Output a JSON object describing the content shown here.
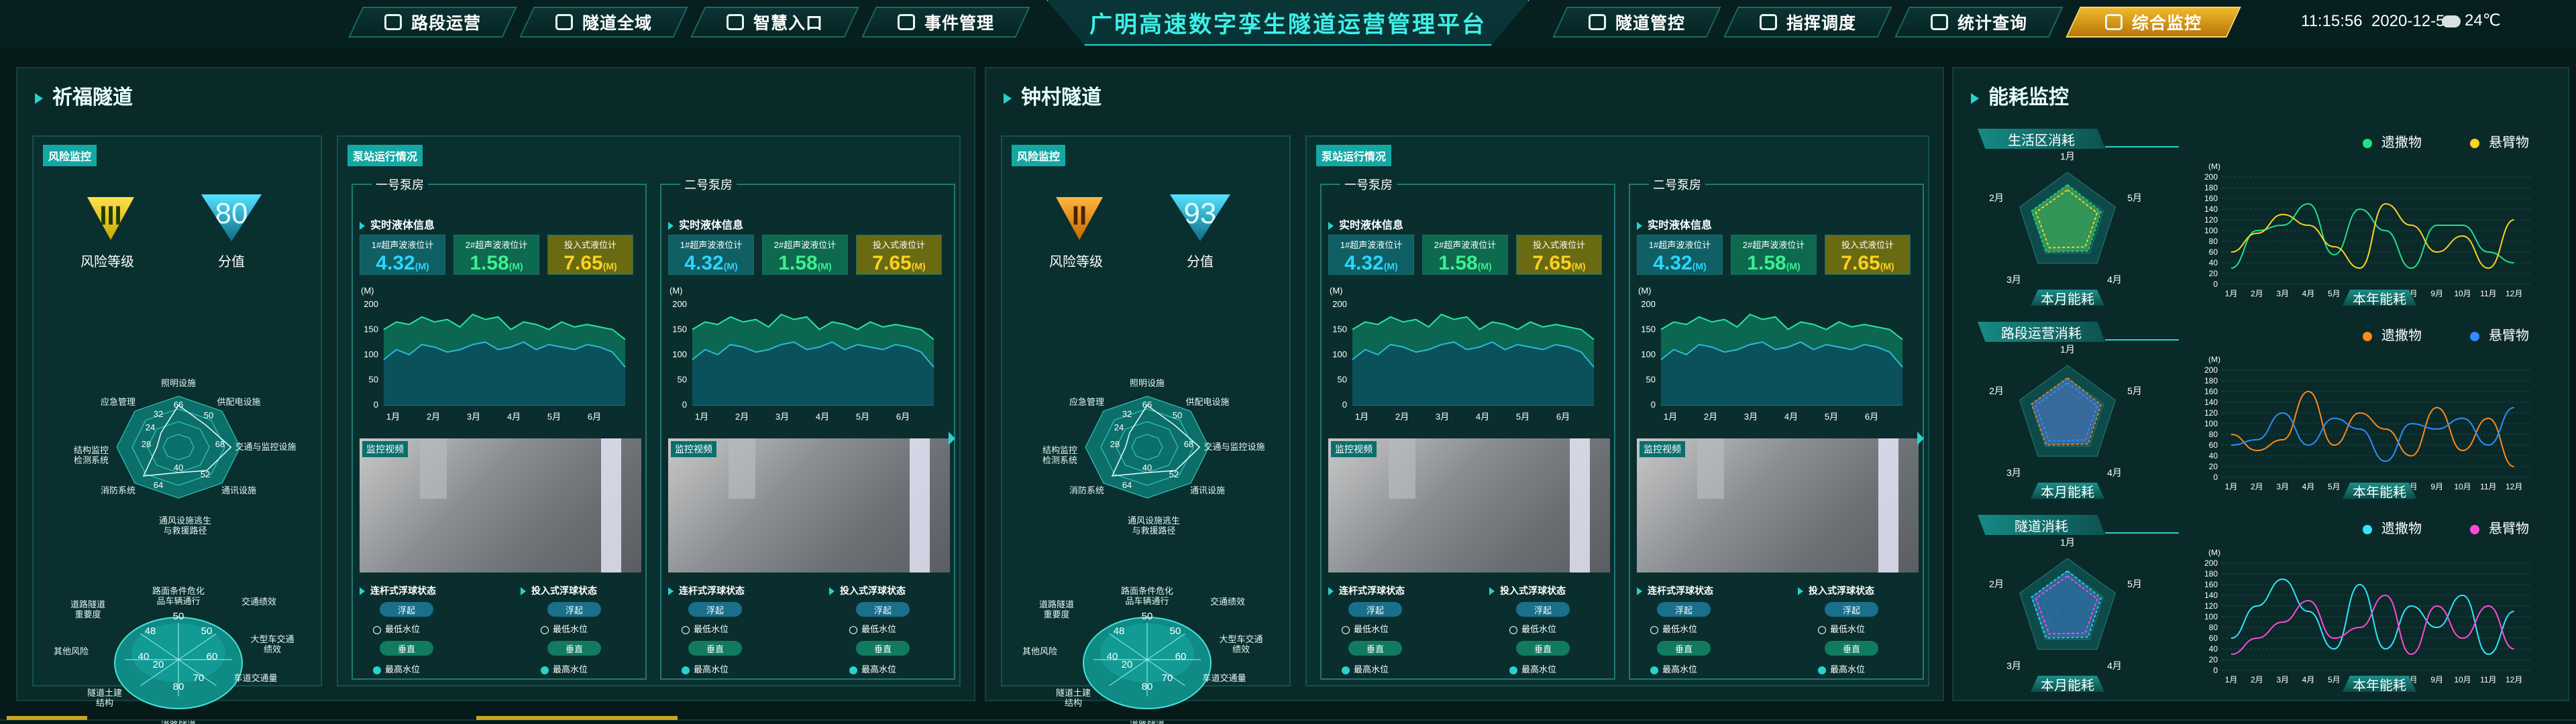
{
  "nav": {
    "left": [
      {
        "label": "路段运营"
      },
      {
        "label": "隧道全域"
      },
      {
        "label": "智慧入口"
      },
      {
        "label": "事件管理"
      }
    ],
    "title": "广明高速数字孪生隧道运营管理平台",
    "right": [
      {
        "label": "隧道管控"
      },
      {
        "label": "指挥调度"
      },
      {
        "label": "统计查询"
      },
      {
        "label": "综合监控"
      }
    ],
    "time": "11:15:56",
    "date": "2020-12-5",
    "weather": "24℃",
    "colors": {
      "accent": "#29d2cd",
      "active": "#f0b82b",
      "bg": "#061a1a"
    }
  },
  "tunnels": [
    {
      "name": "祈福隧道",
      "risk_tag": "风险监控",
      "risk_level": "III",
      "risk_level_label": "风险等级",
      "score": "80",
      "score_label": "分值",
      "radar1": {
        "labels": [
          "照明设施",
          "供配电设施",
          "交通与监控设施",
          "通讯设施",
          "通风设施逃生\n与救援路径",
          "消防系统",
          "结构监控\n检测系统",
          "应急管理"
        ],
        "values": [
          66,
          50,
          68,
          52,
          40,
          64,
          28,
          32,
          24
        ],
        "valuetext": [
          "66",
          "50",
          "68",
          "52",
          "40",
          "64",
          "28",
          "32",
          "24"
        ]
      },
      "radar2": {
        "labels": [
          "路面条件危化\n品车辆通行",
          "交通绩效",
          "大型车交通\n绩效",
          "车道交通量",
          "道路隧道\n线形",
          "隧道土建\n结构",
          "其他风险",
          "道路隧道\n重要度"
        ],
        "vals": [
          "50",
          "50",
          "60",
          "70",
          "80",
          "20",
          "40",
          "48"
        ]
      },
      "pump": {
        "tag": "泵站运行情况",
        "rooms": [
          {
            "name": "一号泵房",
            "section": "实时液体信息",
            "meters": [
              {
                "t": "1#超声波液位计",
                "v": "4.32",
                "u": "(M)"
              },
              {
                "t": "2#超声波液位计",
                "v": "1.58",
                "u": "(M)"
              },
              {
                "t": "投入式液位计",
                "v": "7.65",
                "u": "(M)"
              }
            ]
          },
          {
            "name": "二号泵房",
            "section": "实时液体信息",
            "meters": [
              {
                "t": "1#超声波液位计",
                "v": "4.32",
                "u": "(M)"
              },
              {
                "t": "2#超声波液位计",
                "v": "1.58",
                "u": "(M)"
              },
              {
                "t": "投入式液位计",
                "v": "7.65",
                "u": "(M)"
              }
            ]
          }
        ],
        "video_label": "监控视频",
        "status": {
          "float_title": "连杆式浮球状态",
          "input_title": "投入式浮球状态",
          "btn_float": "浮起",
          "btn_drop": "垂直",
          "low": "最低水位",
          "high": "最高水位"
        }
      }
    },
    {
      "name": "钟村隧道",
      "risk_tag": "风险监控",
      "risk_level": "II",
      "risk_level_label": "风险等级",
      "score": "93",
      "score_label": "分值",
      "radar1": {
        "labels": [
          "照明设施",
          "供配电设施",
          "交通与监控设施",
          "通讯设施",
          "通风设施逃生\n与救援路径",
          "消防系统",
          "结构监控\n检测系统",
          "应急管理"
        ],
        "valuetext": [
          "66",
          "50",
          "68",
          "52",
          "40",
          "64",
          "28",
          "32",
          "24"
        ]
      },
      "radar2": {
        "labels": [
          "路面条件危化\n品车辆通行",
          "交通绩效",
          "大型车交通\n绩效",
          "车道交通量",
          "道路隧道\n线形",
          "隧道土建\n结构",
          "其他风险",
          "道路隧道\n重要度"
        ],
        "vals": [
          "50",
          "50",
          "60",
          "70",
          "80",
          "20",
          "40",
          "48"
        ]
      },
      "pump": {
        "tag": "泵站运行情况",
        "rooms": [
          {
            "name": "一号泵房",
            "section": "实时液体信息",
            "meters": [
              {
                "t": "1#超声波液位计",
                "v": "4.32",
                "u": "(M)"
              },
              {
                "t": "2#超声波液位计",
                "v": "1.58",
                "u": "(M)"
              },
              {
                "t": "投入式液位计",
                "v": "7.65",
                "u": "(M)"
              }
            ]
          },
          {
            "name": "二号泵房",
            "section": "实时液体信息",
            "meters": [
              {
                "t": "1#超声波液位计",
                "v": "4.32",
                "u": "(M)"
              },
              {
                "t": "2#超声波液位计",
                "v": "1.58",
                "u": "(M)"
              },
              {
                "t": "投入式液位计",
                "v": "7.65",
                "u": "(M)"
              }
            ]
          }
        ],
        "video_label": "监控视频",
        "status": {
          "float_title": "连杆式浮球状态",
          "input_title": "投入式浮球状态",
          "btn_float": "浮起",
          "btn_drop": "垂直",
          "low": "最低水位",
          "high": "最高水位"
        }
      }
    }
  ],
  "level_chart": {
    "unit": "(M)",
    "yticks": [
      "200",
      "150",
      "100",
      "50",
      "0"
    ],
    "xticks": [
      "1月",
      "2月",
      "3月",
      "4月",
      "5月",
      "6月"
    ]
  },
  "energy": {
    "title": "能耗监控",
    "month_label": "本月能耗",
    "year_label": "本年能耗",
    "unit": "(M)",
    "yticks": [
      "200",
      "180",
      "160",
      "140",
      "120",
      "100",
      "80",
      "60",
      "40",
      "20",
      "0"
    ],
    "xticks": [
      "1月",
      "2月",
      "3月",
      "4月",
      "5月",
      "6月",
      "7月",
      "8月",
      "9月",
      "10月",
      "11月",
      "12月"
    ],
    "radar_axes": [
      "1月",
      "5月",
      "4月",
      "3月",
      "2月"
    ],
    "groups": [
      {
        "name": "生活区消耗",
        "legend": [
          {
            "label": "遗撒物",
            "color": "#22e08a"
          },
          {
            "label": "悬臂物",
            "color": "#ffd21f"
          }
        ]
      },
      {
        "name": "路段运营消耗",
        "legend": [
          {
            "label": "遗撒物",
            "color": "#ff8a1a"
          },
          {
            "label": "悬臂物",
            "color": "#2f8cff"
          }
        ]
      },
      {
        "name": "隧道消耗",
        "legend": [
          {
            "label": "遗撒物",
            "color": "#2fe6ff"
          },
          {
            "label": "悬臂物",
            "color": "#ff4ad8"
          }
        ]
      }
    ]
  },
  "chart_data": [
    {
      "type": "area",
      "x": [
        "1月",
        "2月",
        "3月",
        "4月",
        "5月",
        "6月"
      ],
      "ylim": [
        0,
        200
      ],
      "ylabel": "(M)",
      "series": [
        {
          "values": [
            150,
            165,
            160,
            175,
            165,
            170,
            155,
            180,
            170,
            175,
            150,
            165,
            160,
            150,
            165,
            155,
            160,
            155,
            150,
            130
          ]
        },
        {
          "values": [
            90,
            110,
            100,
            120,
            115,
            105,
            110,
            120,
            125,
            110,
            115,
            125,
            110,
            120,
            115,
            110,
            120,
            115,
            105,
            75
          ]
        }
      ]
    },
    {
      "type": "line",
      "x": [
        "1月",
        "2月",
        "3月",
        "4月",
        "5月",
        "6月",
        "7月",
        "8月",
        "9月",
        "10月",
        "11月",
        "12月"
      ],
      "ylim": [
        0,
        200
      ],
      "ylabel": "(M)",
      "series": [
        {
          "name": "遗撒物",
          "values": [
            30,
            100,
            110,
            150,
            55,
            140,
            100,
            30,
            110,
            110,
            60,
            40
          ]
        },
        {
          "name": "悬臂物",
          "values": [
            60,
            95,
            130,
            110,
            70,
            30,
            150,
            110,
            60,
            90,
            30,
            120
          ]
        }
      ]
    },
    {
      "type": "line",
      "x": [
        "1月",
        "2月",
        "3月",
        "4月",
        "5月",
        "6月",
        "7月",
        "8月",
        "9月",
        "10月",
        "11月",
        "12月"
      ],
      "ylim": [
        0,
        200
      ],
      "ylabel": "(M)",
      "series": [
        {
          "name": "遗撒物",
          "values": [
            80,
            50,
            70,
            160,
            60,
            120,
            90,
            40,
            130,
            50,
            110,
            20
          ]
        },
        {
          "name": "悬臂物",
          "values": [
            60,
            70,
            120,
            60,
            110,
            90,
            30,
            100,
            90,
            110,
            60,
            130
          ]
        }
      ]
    },
    {
      "type": "line",
      "x": [
        "1月",
        "2月",
        "3月",
        "4月",
        "5月",
        "6月",
        "7月",
        "8月",
        "9月",
        "10月",
        "11月",
        "12月"
      ],
      "ylim": [
        0,
        200
      ],
      "ylabel": "(M)",
      "series": [
        {
          "name": "遗撒物",
          "values": [
            60,
            120,
            170,
            110,
            40,
            160,
            40,
            120,
            80,
            140,
            30,
            110
          ]
        },
        {
          "name": "悬臂物",
          "values": [
            30,
            60,
            90,
            130,
            60,
            80,
            140,
            30,
            120,
            60,
            120,
            40
          ]
        }
      ]
    }
  ]
}
